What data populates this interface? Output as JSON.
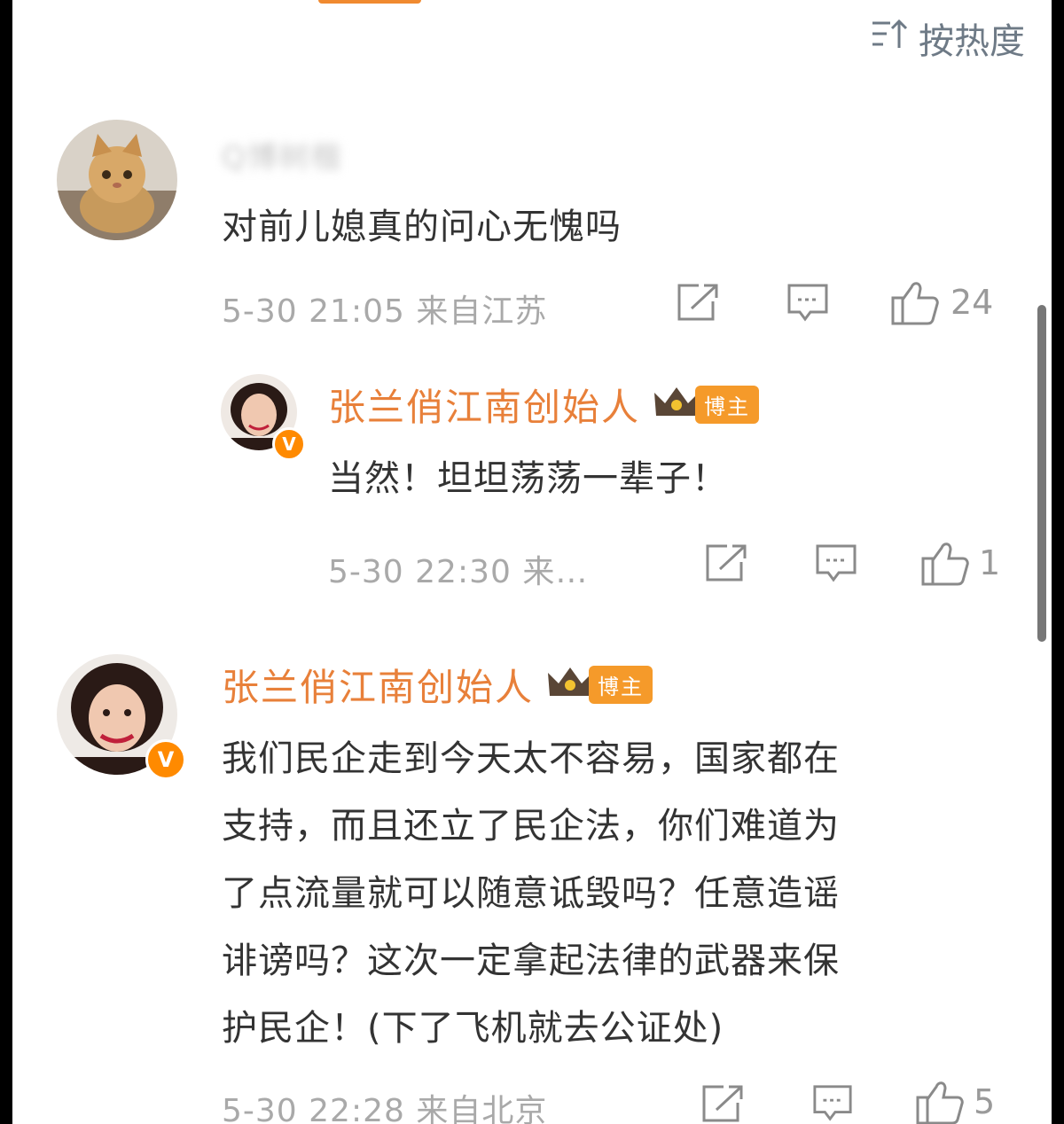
{
  "sort": {
    "icon": "sort-icon",
    "label": "按热度"
  },
  "comments": [
    {
      "username_blurred": "Q博树楷",
      "text": "对前儿媳真的问心无愧吗",
      "date": "5-30",
      "time": "21:05",
      "location": "来自江苏",
      "likes": "24",
      "replies": [
        {
          "username": "张兰俏江南创始人",
          "badge": "博主",
          "text": "当然！坦坦荡荡一辈子！",
          "date": "5-30",
          "time": "22:30",
          "location": "来…",
          "likes": "1"
        }
      ]
    },
    {
      "username": "张兰俏江南创始人",
      "badge": "博主",
      "text_lines": [
        "我们民企走到今天太不容易，国家都在",
        "支持，而且还立了民企法，你们难道为",
        "了点流量就可以随意诋毁吗？任意造谣",
        "诽谤吗？这次一定拿起法律的武器来保",
        "护民企！(下了飞机就去公证处)"
      ],
      "date": "5-30",
      "time": "22:28",
      "location": "来自北京",
      "likes": "5"
    }
  ],
  "colors": {
    "name": "#e8803a",
    "badge": "#f59a2a",
    "verified": "#ff8a00"
  }
}
